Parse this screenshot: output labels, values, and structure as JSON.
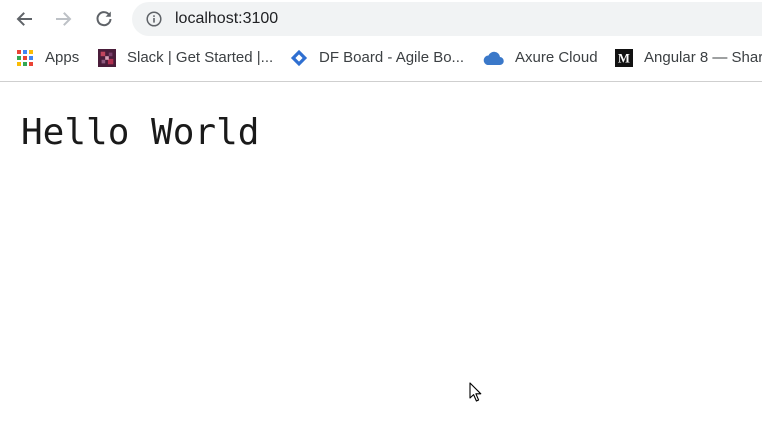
{
  "toolbar": {
    "back_icon": "arrow-left-icon",
    "forward_icon": "arrow-right-icon",
    "reload_icon": "reload-icon",
    "info_icon": "info-circle-icon",
    "url": "localhost:3100"
  },
  "bookmarks": {
    "items": [
      {
        "label": "Apps",
        "icon": "apps-grid-icon"
      },
      {
        "label": "Slack | Get Started |...",
        "icon": "slack-icon"
      },
      {
        "label": "DF Board - Agile Bo...",
        "icon": "diamond-icon"
      },
      {
        "label": "Axure Cloud",
        "icon": "cloud-icon"
      },
      {
        "label": "Angular 8 — Shar",
        "icon": "medium-icon"
      }
    ]
  },
  "page": {
    "heading": "Hello World"
  },
  "colors": {
    "icon": "#5f6368",
    "forward_disabled": "#bdc1c6",
    "omnibox_bg": "#f1f3f4",
    "diamond": "#2f6fd1",
    "cloud": "#3a78c9",
    "text": "#202124"
  }
}
